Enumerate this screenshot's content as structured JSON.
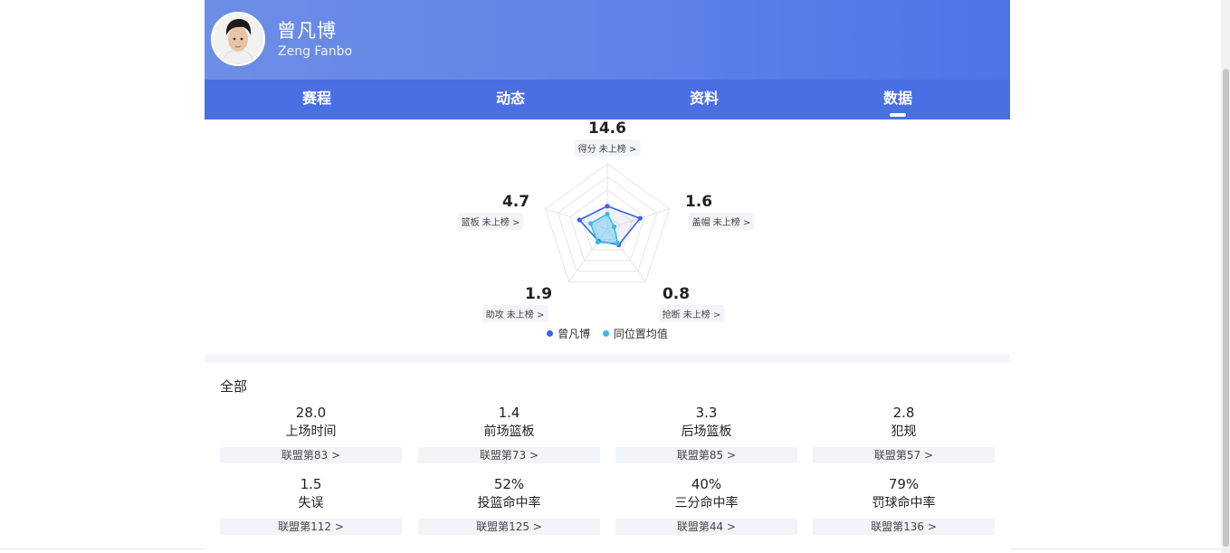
{
  "player": {
    "name": "曾凡博",
    "name_en": "Zeng Fanbo"
  },
  "tabs": [
    {
      "label": "赛程",
      "active": false
    },
    {
      "label": "动态",
      "active": false
    },
    {
      "label": "资料",
      "active": false
    },
    {
      "label": "数据",
      "active": true
    }
  ],
  "radar": {
    "axes": [
      {
        "value": "14.6",
        "label": "得分 未上榜 >",
        "player": 0.35,
        "avg": 0.23
      },
      {
        "value": "1.6",
        "label": "盖帽 未上榜 >",
        "player": 0.53,
        "avg": 0.11
      },
      {
        "value": "0.8",
        "label": "抢断 未上榜 >",
        "player": 0.3,
        "avg": 0.27
      },
      {
        "value": "1.9",
        "label": "助攻 未上榜 >",
        "player": 0.23,
        "avg": 0.25
      },
      {
        "value": "4.7",
        "label": "篮板 未上榜 >",
        "player": 0.45,
        "avg": 0.27
      }
    ],
    "legend": [
      {
        "name": "曾凡博",
        "color": "#3a63e6"
      },
      {
        "name": "同位置均值",
        "color": "#3ab9e6"
      }
    ]
  },
  "section_title": "全部",
  "stats": [
    {
      "value": "28.0",
      "label": "上场时间",
      "rank": "联盟第83 >"
    },
    {
      "value": "1.4",
      "label": "前场篮板",
      "rank": "联盟第73 >"
    },
    {
      "value": "3.3",
      "label": "后场篮板",
      "rank": "联盟第85 >"
    },
    {
      "value": "2.8",
      "label": "犯规",
      "rank": "联盟第57 >"
    },
    {
      "value": "1.5",
      "label": "失误",
      "rank": "联盟第112 >"
    },
    {
      "value": "52%",
      "label": "投篮命中率",
      "rank": "联盟第125 >"
    },
    {
      "value": "40%",
      "label": "三分命中率",
      "rank": "联盟第44 >"
    },
    {
      "value": "79%",
      "label": "罚球命中率",
      "rank": "联盟第136 >"
    }
  ],
  "colors": {
    "header": "#5f83e8",
    "tabs": "#4a6fe3",
    "player_series": "#3a63e6",
    "avg_series": "#3ab9e6"
  }
}
